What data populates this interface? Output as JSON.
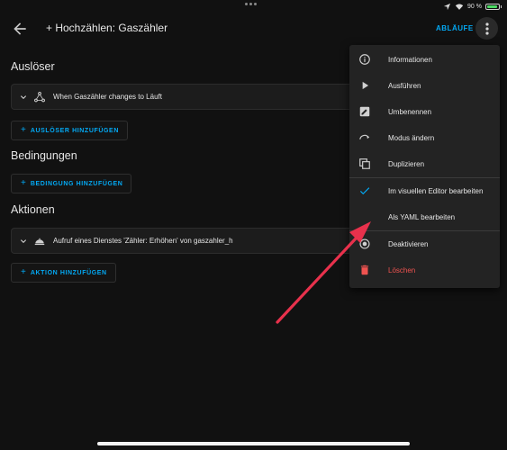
{
  "status_bar": {
    "battery_percent": "90 %",
    "battery_level": 0.9,
    "battery_color": "#4cd964"
  },
  "appbar": {
    "back_icon": "arrow-left-icon",
    "title": "+ Hochzählen: Gaszähler",
    "ablaeufe_label": "ABLÄUFE",
    "more_icon": "dots-vertical-icon"
  },
  "sections": {
    "triggers": {
      "title": "Auslöser",
      "items": [
        {
          "icon": "trigger-icon",
          "text": "When Gaszähler changes to Läuft"
        }
      ],
      "add_label": "AUSLÖSER HINZUFÜGEN"
    },
    "conditions": {
      "title": "Bedingungen",
      "add_label": "BEDINGUNG HINZUFÜGEN"
    },
    "actions": {
      "title": "Aktionen",
      "items": [
        {
          "icon": "service-icon",
          "text": "Aufruf eines Dienstes 'Zähler: Erhöhen' von gaszahler_h"
        }
      ],
      "add_label": "AKTION HINZUFÜGEN"
    }
  },
  "menu": {
    "items": [
      {
        "icon": "information-icon",
        "label": "Informationen"
      },
      {
        "icon": "play-icon",
        "label": "Ausführen"
      },
      {
        "icon": "rename-icon",
        "label": "Umbenennen"
      },
      {
        "icon": "mode-icon",
        "label": "Modus ändern"
      },
      {
        "icon": "duplicate-icon",
        "label": "Duplizieren"
      },
      {
        "icon": "check-icon",
        "label": "Im visuellen Editor bearbeiten"
      },
      {
        "icon": "",
        "label": "Als YAML bearbeiten"
      },
      {
        "icon": "disable-icon",
        "label": "Deaktivieren"
      },
      {
        "icon": "delete-icon",
        "label": "Löschen"
      }
    ]
  },
  "colors": {
    "accent": "#03a9f4",
    "danger": "#ef5350",
    "annotation_arrow": "#e8314c",
    "background": "#111111",
    "card": "#1c1c1c",
    "menu": "#232323"
  }
}
